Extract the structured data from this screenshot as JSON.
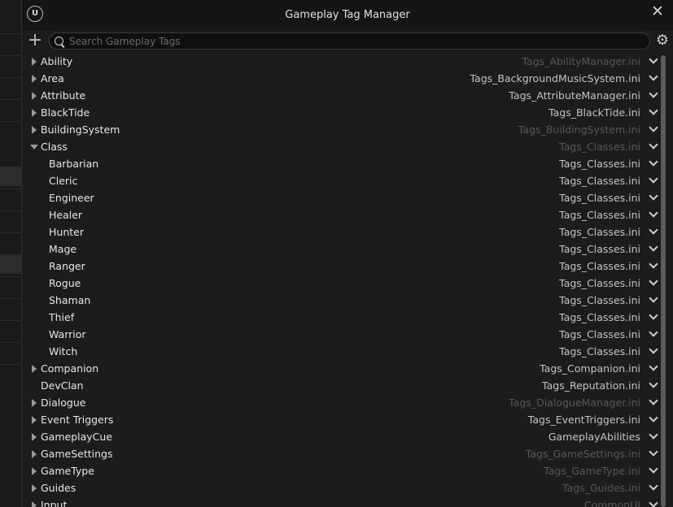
{
  "window": {
    "title": "Gameplay Tag Manager"
  },
  "icons": {
    "logo": "unreal-logo",
    "close": "close-icon",
    "add": "plus-icon",
    "search": "search-icon",
    "settings": "gear-icon",
    "logo_glyph": "U"
  },
  "search": {
    "placeholder": "Search Gameplay Tags",
    "value": ""
  },
  "colors": {
    "background": "#1c1c1c",
    "text": "#e6e6e6",
    "source_text": "#c3c3c3",
    "source_dim": "#585858"
  },
  "tags": [
    {
      "name": "Ability",
      "source": "Tags_AbilityManager.ini",
      "expander": "collapsed",
      "indent": 0,
      "dim": true
    },
    {
      "name": "Area",
      "source": "Tags_BackgroundMusicSystem.ini",
      "expander": "collapsed",
      "indent": 0,
      "dim": false
    },
    {
      "name": "Attribute",
      "source": "Tags_AttributeManager.ini",
      "expander": "collapsed",
      "indent": 0,
      "dim": false
    },
    {
      "name": "BlackTide",
      "source": "Tags_BlackTide.ini",
      "expander": "collapsed",
      "indent": 0,
      "dim": false
    },
    {
      "name": "BuildingSystem",
      "source": "Tags_BuildingSystem.ini",
      "expander": "collapsed",
      "indent": 0,
      "dim": true
    },
    {
      "name": "Class",
      "source": "Tags_Classes.ini",
      "expander": "expanded",
      "indent": 0,
      "dim": true
    },
    {
      "name": "Barbarian",
      "source": "Tags_Classes.ini",
      "expander": "none",
      "indent": 1,
      "dim": false
    },
    {
      "name": "Cleric",
      "source": "Tags_Classes.ini",
      "expander": "none",
      "indent": 1,
      "dim": false
    },
    {
      "name": "Engineer",
      "source": "Tags_Classes.ini",
      "expander": "none",
      "indent": 1,
      "dim": false
    },
    {
      "name": "Healer",
      "source": "Tags_Classes.ini",
      "expander": "none",
      "indent": 1,
      "dim": false
    },
    {
      "name": "Hunter",
      "source": "Tags_Classes.ini",
      "expander": "none",
      "indent": 1,
      "dim": false
    },
    {
      "name": "Mage",
      "source": "Tags_Classes.ini",
      "expander": "none",
      "indent": 1,
      "dim": false
    },
    {
      "name": "Ranger",
      "source": "Tags_Classes.ini",
      "expander": "none",
      "indent": 1,
      "dim": false
    },
    {
      "name": "Rogue",
      "source": "Tags_Classes.ini",
      "expander": "none",
      "indent": 1,
      "dim": false
    },
    {
      "name": "Shaman",
      "source": "Tags_Classes.ini",
      "expander": "none",
      "indent": 1,
      "dim": false
    },
    {
      "name": "Thief",
      "source": "Tags_Classes.ini",
      "expander": "none",
      "indent": 1,
      "dim": false
    },
    {
      "name": "Warrior",
      "source": "Tags_Classes.ini",
      "expander": "none",
      "indent": 1,
      "dim": false
    },
    {
      "name": "Witch",
      "source": "Tags_Classes.ini",
      "expander": "none",
      "indent": 1,
      "dim": false
    },
    {
      "name": "Companion",
      "source": "Tags_Companion.ini",
      "expander": "collapsed",
      "indent": 0,
      "dim": false
    },
    {
      "name": "DevClan",
      "source": "Tags_Reputation.ini",
      "expander": "none",
      "indent": 0,
      "dim": false
    },
    {
      "name": "Dialogue",
      "source": "Tags_DialogueManager.ini",
      "expander": "collapsed",
      "indent": 0,
      "dim": true
    },
    {
      "name": "Event Triggers",
      "source": "Tags_EventTriggers.ini",
      "expander": "collapsed",
      "indent": 0,
      "dim": false
    },
    {
      "name": "GameplayCue",
      "source": "GameplayAbilities",
      "expander": "collapsed",
      "indent": 0,
      "dim": false
    },
    {
      "name": "GameSettings",
      "source": "Tags_GameSettings.ini",
      "expander": "collapsed",
      "indent": 0,
      "dim": true
    },
    {
      "name": "GameType",
      "source": "Tags_GameType.ini",
      "expander": "collapsed",
      "indent": 0,
      "dim": true
    },
    {
      "name": "Guides",
      "source": "Tags_Guides.ini",
      "expander": "collapsed",
      "indent": 0,
      "dim": true
    },
    {
      "name": "Input",
      "source": "CommonUI",
      "expander": "collapsed",
      "indent": 0,
      "dim": true
    }
  ]
}
